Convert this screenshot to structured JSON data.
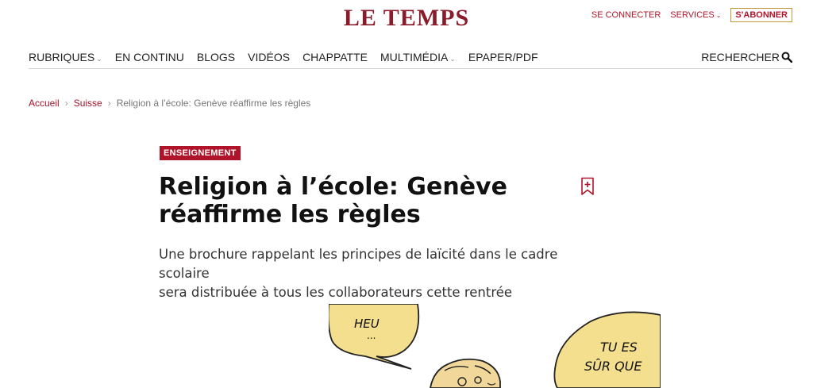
{
  "header": {
    "logo": "LE TEMPS",
    "login": "SE CONNECTER",
    "services": "SERVICES",
    "subscribe": "S'ABONNER"
  },
  "nav": {
    "items": [
      "RUBRIQUES",
      "EN CONTINU",
      "BLOGS",
      "VIDÉOS",
      "CHAPPATTE",
      "MULTIMÉDIA",
      "EPAPER/PDF"
    ],
    "search": "RECHERCHER"
  },
  "breadcrumb": {
    "home": "Accueil",
    "section": "Suisse",
    "current": "Religion à l’école: Genève réaffirme les règles"
  },
  "article": {
    "category": "ENSEIGNEMENT",
    "title_line1": "Religion à l’école: Genève",
    "title_line2": "réaffirme les règles",
    "lede_line1": "Une brochure rappelant les principes de laïcité dans le cadre scolaire",
    "lede_line2": "sera distribuée à tous les collaborateurs cette rentrée"
  },
  "cartoon": {
    "bubble1": "HEU",
    "bubble1_dots": "...",
    "bubble2_line1": "TU ES",
    "bubble2_line2": "SÛR QUE"
  },
  "colors": {
    "brand": "#8a1b2b",
    "accent": "#b0142a",
    "bubble": "#f3df8e"
  }
}
